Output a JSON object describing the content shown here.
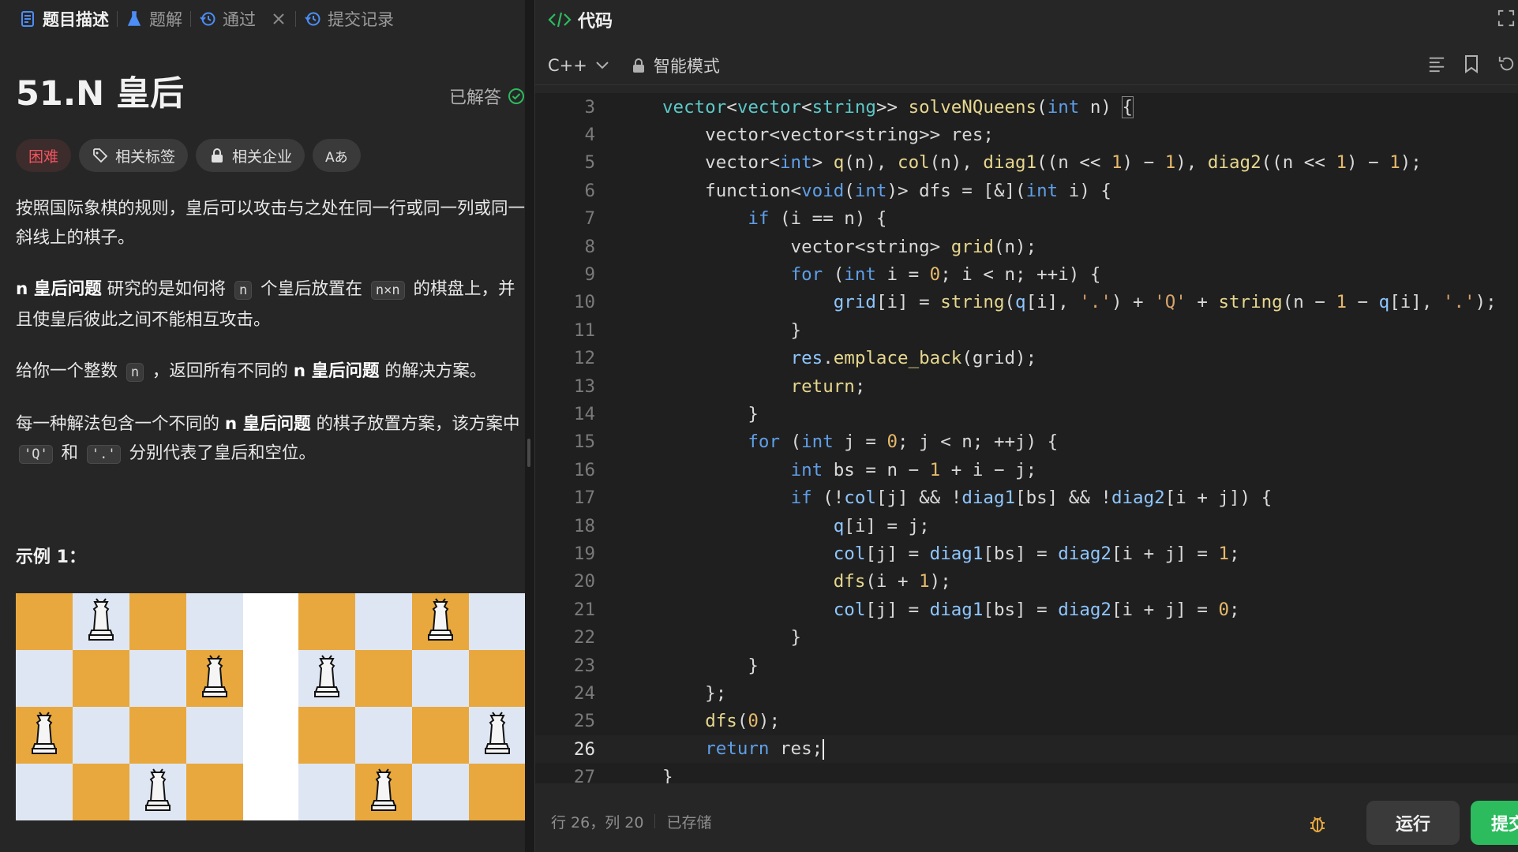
{
  "left_tabs": [
    {
      "label": "题目描述",
      "icon": "document-icon"
    },
    {
      "label": "题解",
      "icon": "flask-icon"
    },
    {
      "label": "通过",
      "icon": "history-icon"
    },
    {
      "label": "提交记录",
      "icon": "history-icon"
    }
  ],
  "problem": {
    "title": "51.N 皇后",
    "solved_label": "已解答",
    "tags": {
      "difficulty": "困难",
      "related_tags": "相关标签",
      "related_companies": "相关企业",
      "font": "Aあ"
    },
    "desc": {
      "p1": "按照国际象棋的规则，皇后可以攻击与之处在同一行或同一列或同一斜线上的棋子。",
      "p2_bold1": "n 皇后问题",
      "p2_t1": " 研究的是如何将 ",
      "p2_code1": "n",
      "p2_t2": " 个皇后放置在 ",
      "p2_code2": "n×n",
      "p2_t3": " 的棋盘上，并且使皇后彼此之间不能相互攻击。",
      "p3_t1": "给你一个整数 ",
      "p3_code1": "n",
      "p3_t2": " ，返回所有不同的 ",
      "p3_bold1": "n 皇后问题",
      "p3_t3": " 的解决方案。",
      "p4_t1": "每一种解法包含一个不同的 ",
      "p4_bold1": "n 皇后问题",
      "p4_t2": " 的棋子放置方案，该方案中 ",
      "p4_code1": "'Q'",
      "p4_t3": " 和 ",
      "p4_code2": "'.'",
      "p4_t4": " 分别代表了皇后和空位。"
    },
    "example_title": "示例 1："
  },
  "code_panel": {
    "title": "代码",
    "language": "C++",
    "mode": "智能模式",
    "status_position": "行 26，列 20",
    "status_saved": "已存储",
    "run_label": "运行",
    "submit_label": "提交"
  },
  "code_lines": [
    {
      "n": "3"
    },
    {
      "n": "4"
    },
    {
      "n": "5"
    },
    {
      "n": "6"
    },
    {
      "n": "7"
    },
    {
      "n": "8"
    },
    {
      "n": "9"
    },
    {
      "n": "10"
    },
    {
      "n": "11"
    },
    {
      "n": "12"
    },
    {
      "n": "13"
    },
    {
      "n": "14"
    },
    {
      "n": "15"
    },
    {
      "n": "16"
    },
    {
      "n": "17"
    },
    {
      "n": "18"
    },
    {
      "n": "19"
    },
    {
      "n": "20"
    },
    {
      "n": "21"
    },
    {
      "n": "22"
    },
    {
      "n": "23"
    },
    {
      "n": "24"
    },
    {
      "n": "25"
    },
    {
      "n": "26"
    },
    {
      "n": "27"
    }
  ],
  "colors": {
    "accent_green": "#2cbb5d",
    "hard_red": "#f2535e",
    "board_dark": "#e8a83e",
    "board_light": "#dfe6f3"
  }
}
